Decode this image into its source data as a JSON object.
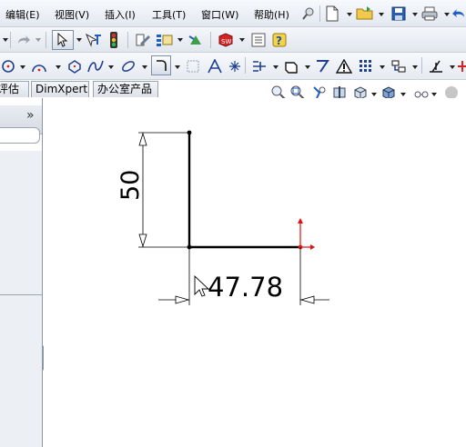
{
  "menubar": {
    "items": [
      {
        "id": "edit",
        "label": "编辑(E)"
      },
      {
        "id": "view",
        "label": "视图(V)"
      },
      {
        "id": "insert",
        "label": "插入(I)"
      },
      {
        "id": "tools",
        "label": "工具(T)"
      },
      {
        "id": "window",
        "label": "窗口(W)"
      },
      {
        "id": "help",
        "label": "帮助(H)"
      }
    ]
  },
  "tabs": {
    "evaluate_partial": "评估",
    "dimxpert": "DimXpert",
    "office_products": "办公室产品"
  },
  "panel": {
    "collapse_glyph": "»"
  },
  "sketch": {
    "vertical_dimension": "50",
    "horizontal_dimension": "47.78"
  },
  "colors": {
    "menubar_bg": "#eef1f6",
    "sketch_line": "#000000",
    "origin_red": "#e01010",
    "accent_blue": "#1f5fbf"
  },
  "icons": {
    "menubar": [
      "pin-icon",
      "new-document-icon",
      "open-folder-icon",
      "save-icon",
      "print-icon",
      "undo-icon"
    ],
    "toolbar1": [
      "redo-icon",
      "select-icon",
      "rebuild-icon",
      "traffic-light-icon",
      "options-icon",
      "file-properties-icon",
      "solidworks-icon",
      "list-icon",
      "help-icon"
    ],
    "toolbar2": [
      "circle-icon",
      "arc-icon",
      "polygon-icon",
      "spline-icon",
      "ellipse-icon",
      "fillet-icon",
      "chamfer-icon",
      "text-icon",
      "point-icon",
      "trim-icon",
      "offset-icon",
      "mirror-icon",
      "warning-icon",
      "pattern-icon",
      "move-icon",
      "relations-icon"
    ],
    "viewbar": [
      "zoom-to-fit-icon",
      "zoom-area-icon",
      "previous-view-icon",
      "section-view-icon",
      "view-orientation-icon",
      "display-style-icon",
      "hide-show-icon",
      "appearance-icon"
    ]
  }
}
